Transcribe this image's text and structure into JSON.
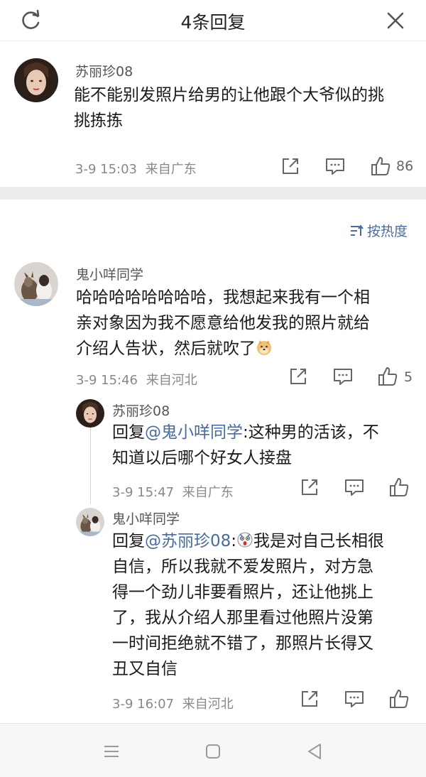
{
  "header": {
    "title": "4条回复",
    "left_icon": "refresh-icon",
    "right_icon": "close-icon"
  },
  "root": {
    "user": "苏丽珍08",
    "content_line1": "能不能别发照片给男的让他跟个大爷似的挑",
    "content_line2": "挑拣拣",
    "time": "3-9 15:03",
    "location": "来自广东",
    "like_count": "86"
  },
  "sort": {
    "label": "按热度",
    "icon": "sort-icon"
  },
  "replies": [
    {
      "user": "鬼小咩同学",
      "lines": [
        "哈哈哈哈哈哈哈哈，我想起来我有一个相",
        "亲对象因为我不愿意给他发我的照片就给",
        "介绍人告状，然后就吹了"
      ],
      "time": "3-9 15:46",
      "location": "来自河北",
      "like_count": "5"
    },
    {
      "user": "苏丽珍08",
      "prefix": "回复",
      "mention": "@鬼小咩同学",
      "line1_rest": ":这种男的活该，不",
      "line2": "知道以后哪个好女人接盘",
      "time": "3-9 15:47",
      "location": "来自广东"
    },
    {
      "user": "鬼小咩同学",
      "prefix": "回复",
      "mention": "@苏丽珍08",
      "line1_rest": "我是对自己长相很",
      "lines": [
        "自信，所以我就不爱发照片，对方急",
        "得一个劲儿非要看照片，还让他挑上",
        "了，我从介绍人那里看过他照片没第",
        "一时间拒绝就不错了，那照片长得又",
        "丑又自信"
      ],
      "time": "3-9 16:07",
      "location": "来自河北"
    }
  ],
  "colors": {
    "link": "#4a6b9b",
    "divider": "#ececec"
  }
}
